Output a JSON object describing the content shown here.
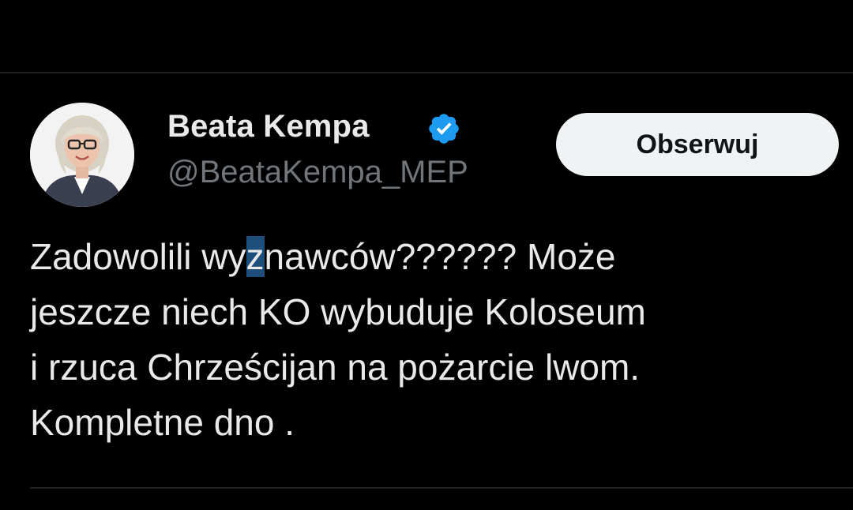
{
  "profile": {
    "display_name": "Beata Kempa",
    "handle": "@BeataKempa_MEP",
    "verified": true,
    "verified_icon": "verified-badge-icon",
    "avatar_icon": "profile-photo"
  },
  "actions": {
    "follow_label": "Obserwuj"
  },
  "tweet": {
    "line1_part1": "Zadowolili wy",
    "line1_cursor_char": "z",
    "line1_part2": "nawców?????? Może",
    "line2": "jeszcze niech KO wybuduje Koloseum",
    "line3": "i rzuca Chrześcijan na pożarcie lwom.",
    "line4": "Kompletne dno ."
  },
  "colors": {
    "background": "#000000",
    "text": "#e7e9ea",
    "secondary_text": "#71767b",
    "verified_blue": "#1d9bf0",
    "follow_button_bg": "#eff3f4",
    "follow_button_text": "#0f1419",
    "selection_highlight": "#1d4f7a"
  }
}
